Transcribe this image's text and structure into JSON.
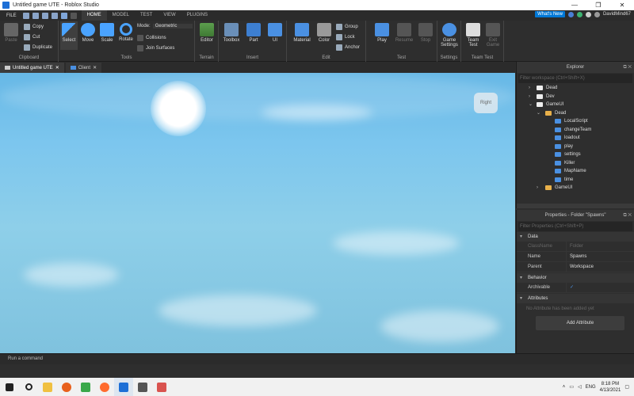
{
  "window": {
    "title": "Untitled game UTE - Roblox Studio",
    "controls": [
      "—",
      "❐",
      "✕"
    ]
  },
  "menubar": {
    "file": "FILE",
    "tabs": [
      "HOME",
      "MODEL",
      "TEST",
      "VIEW",
      "PLUGINS"
    ],
    "active_tab": "HOME",
    "whats_new": "What's New",
    "username": "DavidMind67"
  },
  "ribbon": {
    "clipboard": {
      "label": "Clipboard",
      "paste": "Paste",
      "copy": "Copy",
      "cut": "Cut",
      "duplicate": "Duplicate"
    },
    "tools": {
      "label": "Tools",
      "select": "Select",
      "move": "Move",
      "scale": "Scale",
      "rotate": "Rotate",
      "mode_label": "Mode:",
      "mode_value": "Geometric",
      "collisions": "Collisions",
      "join_surfaces": "Join Surfaces"
    },
    "terrain": {
      "label": "Terrain",
      "editor": "Editor"
    },
    "insert": {
      "label": "Insert",
      "toolbox": "Toolbox",
      "part": "Part",
      "ui": "UI"
    },
    "edit": {
      "label": "Edit",
      "material": "Material",
      "color": "Color",
      "group": "Group",
      "lock": "Lock",
      "anchor": "Anchor"
    },
    "test": {
      "label": "Test",
      "play": "Play",
      "resume": "Resume",
      "stop": "Stop"
    },
    "settings": {
      "label": "Settings",
      "game_settings_1": "Game",
      "game_settings_2": "Settings"
    },
    "team_test": {
      "label": "Team Test",
      "team_test_1": "Team",
      "team_test_2": "Test",
      "exit_game_1": "Exit",
      "exit_game_2": "Game"
    }
  },
  "doc_tabs": [
    {
      "label": "Untitled game UTE"
    },
    {
      "label": "Client"
    }
  ],
  "viewport": {
    "view_cube_label": "Right",
    "ui_toggle": "UI"
  },
  "explorer": {
    "title": "Explorer",
    "filter_placeholder": "Filter workspace (Ctrl+Shift+X)",
    "items": [
      "Dead",
      "Dev",
      "GameUI",
      "Dead",
      "LocalScript",
      "changeTeam",
      "loadout",
      "play",
      "settings",
      "Killer",
      "MapName",
      "time",
      "GameUI"
    ]
  },
  "properties": {
    "title": "Properties - Folder \"Spawns\"",
    "filter_placeholder": "Filter Properties (Ctrl+Shift+P)",
    "sections": {
      "data": "Data",
      "behavior": "Behavior",
      "attributes": "Attributes"
    },
    "classname_key": "ClassName",
    "classname_value": "Folder",
    "name_key": "Name",
    "name_value": "Spawns",
    "parent_key": "Parent",
    "parent_value": "Workspace",
    "archivable_key": "Archivable",
    "archivable_value": "✓",
    "no_attr": "No Attribute has been added yet",
    "add_attribute": "Add Attribute"
  },
  "command_bar": {
    "placeholder": "Run a command"
  },
  "taskbar": {
    "lang": "ENG",
    "time": "8:18 PM",
    "date": "4/13/2021"
  },
  "colors": {
    "accent": "#00a2ff",
    "whats_new": "#0078d7",
    "folder": "#e8b04a",
    "script": "#4a90e2",
    "bg": "#2e2e2e"
  }
}
